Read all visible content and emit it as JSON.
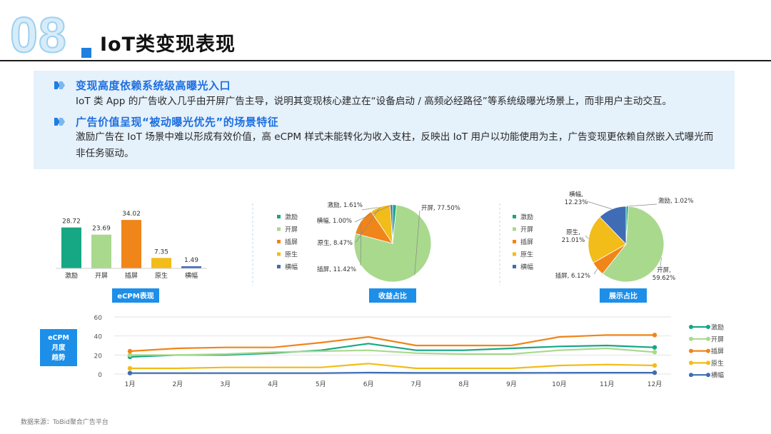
{
  "header": {
    "section_number": "08",
    "title": "IoT类变现表现",
    "accent_color": "#1d7fe0"
  },
  "insights": [
    {
      "heading": "变现高度依赖系统级高曝光入口",
      "text": "IoT 类 App 的广告收入几乎由开屏广告主导，说明其变现核心建立在“设备启动 / 高频必经路径”等系统级曝光场景上，而非用户主动交互。"
    },
    {
      "heading": "广告价值呈现“被动曝光优先”的场景特征",
      "text": "激励广告在 IoT 场景中难以形成有效价值，高 eCPM 样式未能转化为收入支柱，反映出 IoT 用户以功能使用为主，广告变现更依赖自然嵌入式曝光而非任务驱动。"
    }
  ],
  "footer": {
    "source": "数据来源：ToBid聚合广告平台"
  },
  "chart_data": [
    {
      "type": "bar",
      "title": "eCPM表现",
      "categories": [
        "激励",
        "开屏",
        "插屏",
        "原生",
        "横幅"
      ],
      "values": [
        28.72,
        23.69,
        34.02,
        7.35,
        1.49
      ],
      "colors": [
        "#16a784",
        "#a9d98d",
        "#f08519",
        "#f2bc19",
        "#3f6cb4"
      ],
      "ylim": [
        0,
        40
      ]
    },
    {
      "type": "pie",
      "title": "收益占比",
      "labels": [
        "激励",
        "开屏",
        "插屏",
        "原生",
        "横幅"
      ],
      "values": [
        1.61,
        77.5,
        11.42,
        8.47,
        1.0
      ],
      "slice_labels": [
        "激励, 1.61%",
        "开屏, 77.50%",
        "插屏, 11.42%",
        "原生, 8.47%",
        "横幅, 1.00%"
      ],
      "colors": [
        "#16a784",
        "#a9d98d",
        "#f08519",
        "#f2bc19",
        "#3f6cb4"
      ],
      "legend": "left"
    },
    {
      "type": "pie",
      "title": "展示占比",
      "labels": [
        "激励",
        "开屏",
        "插屏",
        "原生",
        "横幅"
      ],
      "values": [
        1.02,
        59.62,
        6.12,
        21.01,
        12.23
      ],
      "slice_labels": [
        "激励, 1.02%",
        "开屏, 59.62%",
        "插屏, 6.12%",
        "原生, 21.01%",
        "横幅, 12.23%"
      ],
      "colors": [
        "#16a784",
        "#a9d98d",
        "#f08519",
        "#f2bc19",
        "#3f6cb4"
      ],
      "legend": "left"
    },
    {
      "type": "line",
      "title": "eCPM月度趋势",
      "categories": [
        "1月",
        "2月",
        "3月",
        "4月",
        "5月",
        "6月",
        "7月",
        "8月",
        "9月",
        "10月",
        "11月",
        "12月"
      ],
      "ylim": [
        0,
        60
      ],
      "yticks": [
        0,
        20,
        40,
        60
      ],
      "grid": true,
      "legend": "right",
      "series": [
        {
          "name": "激励",
          "color": "#16a784",
          "values": [
            18,
            20,
            20,
            22,
            25,
            32,
            25,
            25,
            27,
            29,
            30,
            28
          ]
        },
        {
          "name": "开屏",
          "color": "#a9d98d",
          "values": [
            20,
            20,
            21,
            23,
            24,
            25,
            22,
            21,
            21,
            25,
            27,
            23
          ]
        },
        {
          "name": "插屏",
          "color": "#f08519",
          "values": [
            24,
            27,
            28,
            28,
            33,
            39,
            30,
            30,
            30,
            39,
            41,
            41
          ]
        },
        {
          "name": "原生",
          "color": "#f2bc19",
          "values": [
            6,
            6,
            7,
            7,
            7,
            11,
            6,
            6,
            6,
            9,
            10,
            9
          ]
        },
        {
          "name": "横幅",
          "color": "#3f6cb4",
          "values": [
            1,
            1,
            1,
            1,
            1,
            1.5,
            1.2,
            1.2,
            1.2,
            1.3,
            1.4,
            1.4
          ]
        }
      ]
    }
  ]
}
